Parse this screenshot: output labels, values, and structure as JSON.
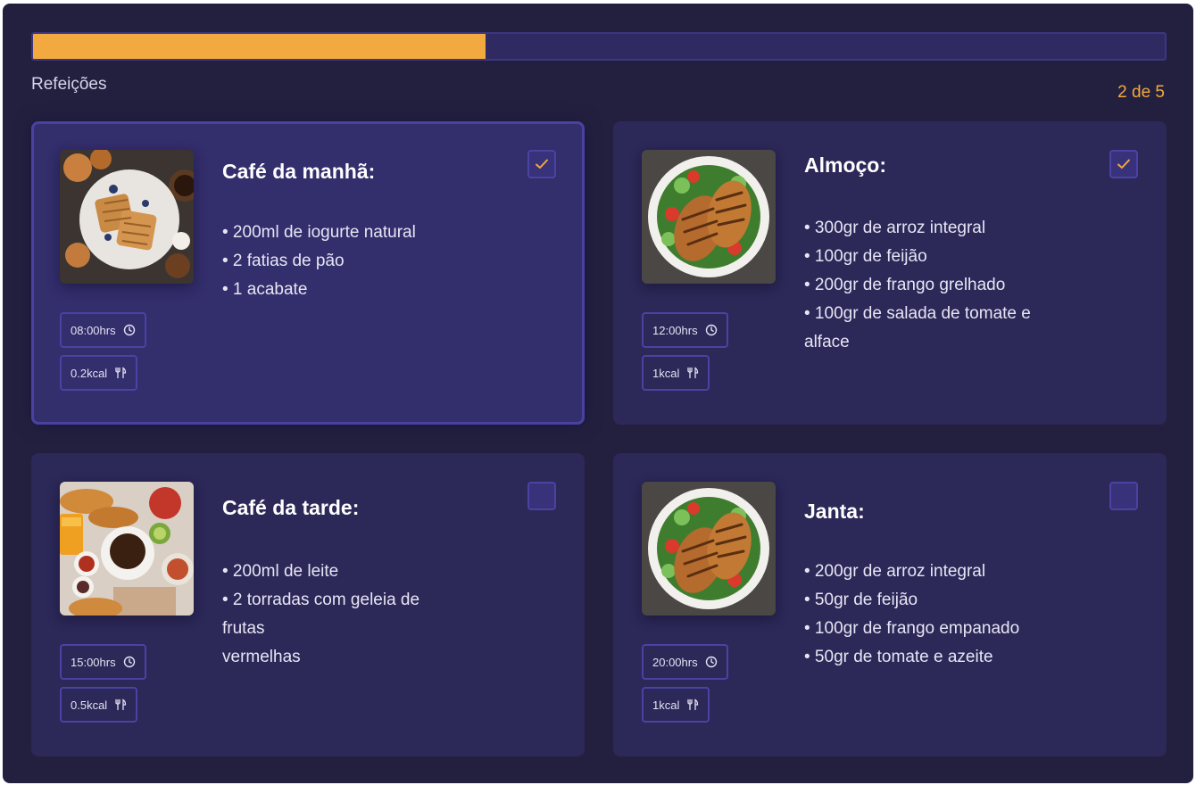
{
  "header": {
    "section_label": "Refeições",
    "counter": "2 de 5",
    "progress_fraction": 0.4,
    "progress_color": "#f2a93f"
  },
  "meals": [
    {
      "title": "Café da manhã:",
      "items": [
        "• 200ml de iogurte natural",
        "• 2 fatias de pão",
        "• 1 acabate"
      ],
      "time": "08:00hrs",
      "calories": "0.2kcal",
      "checked": true,
      "image": "waffles-breakfast-photo"
    },
    {
      "title": "Almoço:",
      "items": [
        "• 300gr de arroz integral",
        "• 100gr de feijão",
        "• 200gr de frango grelhado",
        "• 100gr de salada de tomate e",
        "alface"
      ],
      "time": "12:00hrs",
      "calories": "1kcal",
      "checked": true,
      "image": "grilled-chicken-salad-photo"
    },
    {
      "title": "Café da tarde:",
      "items": [
        "• 200ml de leite",
        "• 2 torradas com geleia de",
        "frutas",
        "vermelhas"
      ],
      "time": "15:00hrs",
      "calories": "0.5kcal",
      "checked": false,
      "image": "coffee-croissant-photo"
    },
    {
      "title": "Janta:",
      "items": [
        "• 200gr de arroz integral",
        "• 50gr de feijão",
        "• 100gr de frango empanado",
        "• 50gr de tomate e azeite"
      ],
      "time": "20:00hrs",
      "calories": "1kcal",
      "checked": false,
      "image": "grilled-chicken-salad-photo"
    }
  ],
  "icons": {
    "time": "clock-icon",
    "calories": "fork-knife-icon",
    "check": "checkmark-icon"
  }
}
